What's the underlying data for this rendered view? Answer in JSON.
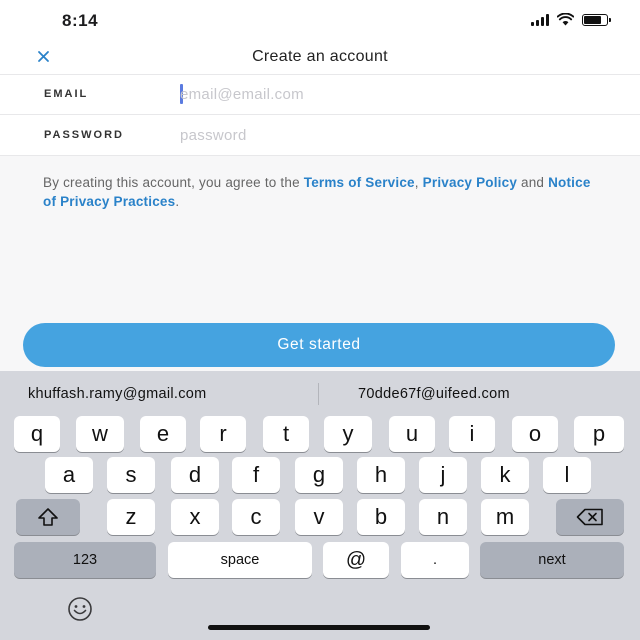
{
  "status_bar": {
    "time": "8:14"
  },
  "header": {
    "title": "Create an account"
  },
  "form": {
    "email": {
      "label": "EMAIL",
      "placeholder": "email@email.com",
      "value": ""
    },
    "password": {
      "label": "PASSWORD",
      "placeholder": "password",
      "value": ""
    }
  },
  "legal": {
    "prefix": "By creating this account, you agree to the ",
    "terms": "Terms of Service",
    "sep1": ", ",
    "privacy": "Privacy Policy",
    "sep2": " and ",
    "notice": "Notice of Privacy Practices",
    "suffix": "."
  },
  "cta": {
    "label": "Get started"
  },
  "colors": {
    "accent": "#45a3e0",
    "link": "#2a82c9",
    "keyboard_bg": "#d4d6dc"
  },
  "keyboard": {
    "suggestions": [
      "khuffash.ramy@gmail.com",
      "70dde67f@uifeed.com"
    ],
    "row1": [
      "q",
      "w",
      "e",
      "r",
      "t",
      "y",
      "u",
      "i",
      "o",
      "p"
    ],
    "row2": [
      "a",
      "s",
      "d",
      "f",
      "g",
      "h",
      "j",
      "k",
      "l"
    ],
    "row3": [
      "z",
      "x",
      "c",
      "v",
      "b",
      "n",
      "m"
    ],
    "bottom": {
      "numbers": "123",
      "space": "space",
      "at": "@",
      "dot": ".",
      "next": "next"
    },
    "icons": {
      "shift": "shift-icon",
      "backspace": "backspace-icon",
      "emoji": "emoji-icon"
    }
  }
}
